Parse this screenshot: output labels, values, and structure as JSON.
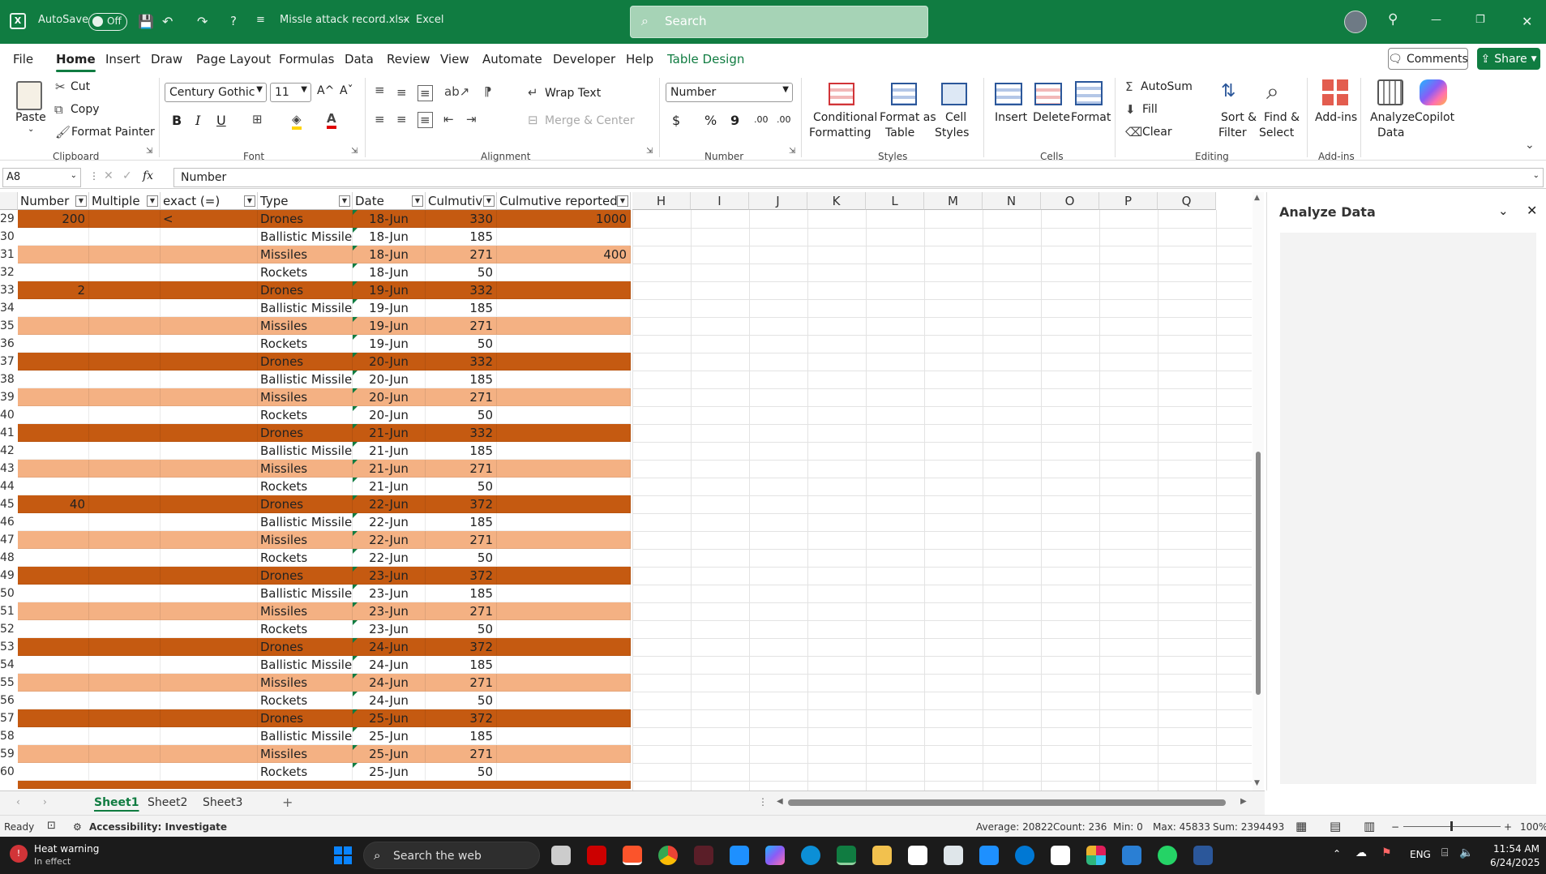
{
  "titlebar": {
    "autosave_label": "AutoSave",
    "autosave_state": "Off",
    "filename": "Missle attack record.xlsx",
    "separator": "-",
    "app_name": "Excel",
    "search_placeholder": "Search"
  },
  "menu": {
    "tabs": [
      "File",
      "Home",
      "Insert",
      "Draw",
      "Page Layout",
      "Formulas",
      "Data",
      "Review",
      "View",
      "Automate",
      "Developer",
      "Help",
      "Table Design"
    ],
    "active": "Home",
    "comments_label": "Comments",
    "share_label": "Share"
  },
  "ribbon": {
    "clipboard": {
      "paste": "Paste",
      "cut": "Cut",
      "copy": "Copy",
      "format_painter": "Format Painter",
      "group": "Clipboard"
    },
    "font": {
      "name": "Century Gothic",
      "size": "11",
      "bold": "B",
      "italic": "I",
      "underline": "U",
      "grow": "A^",
      "shrink": "Aˇ",
      "group": "Font"
    },
    "alignment": {
      "wrap_text": "Wrap Text",
      "merge_center": "Merge & Center",
      "group": "Alignment"
    },
    "number": {
      "format": "Number",
      "currency": "$",
      "percent": "%",
      "comma": "9",
      "increase_decimal": ".00",
      "decrease_decimal": ".00",
      "group": "Number"
    },
    "styles": {
      "conditional": "Conditional",
      "conditional_2": "Formatting",
      "format_table": "Format as",
      "format_table_2": "Table",
      "cell_styles": "Cell",
      "cell_styles_2": "Styles",
      "group": "Styles"
    },
    "cells": {
      "insert": "Insert",
      "delete": "Delete",
      "format": "Format",
      "group": "Cells"
    },
    "editing": {
      "autosum": "AutoSum",
      "fill": "Fill",
      "clear": "Clear",
      "sort": "Sort &",
      "sort_2": "Filter",
      "find": "Find &",
      "find_2": "Select",
      "group": "Editing"
    },
    "addins": {
      "addins": "Add-ins",
      "group": "Add-ins"
    },
    "analyze": {
      "label": "Analyze",
      "label_2": "Data"
    },
    "copilot": {
      "label": "Copilot"
    }
  },
  "formula_bar": {
    "name_box": "A8",
    "fx": "fx",
    "content": "Number"
  },
  "sheet": {
    "headers": [
      "Number",
      "Multiple",
      "exact (=)",
      "Type",
      "Date",
      "Culmutive",
      "Culmutive reported"
    ],
    "extra_columns": [
      "H",
      "I",
      "J",
      "K",
      "L",
      "M",
      "N",
      "O",
      "P",
      "Q"
    ],
    "rows": [
      {
        "n": "29",
        "num": "200",
        "mult": "",
        "exact": "<",
        "type": "Drones",
        "date": "18-Jun",
        "cum": "330",
        "rep": "1000",
        "band": "dark"
      },
      {
        "n": "30",
        "num": "",
        "mult": "",
        "exact": "",
        "type": "Ballistic Missiles",
        "date": "18-Jun",
        "cum": "185",
        "rep": "",
        "band": "white"
      },
      {
        "n": "31",
        "num": "",
        "mult": "",
        "exact": "",
        "type": "Missiles",
        "date": "18-Jun",
        "cum": "271",
        "rep": "400",
        "band": "light"
      },
      {
        "n": "32",
        "num": "",
        "mult": "",
        "exact": "",
        "type": "Rockets",
        "date": "18-Jun",
        "cum": "50",
        "rep": "",
        "band": "white"
      },
      {
        "n": "33",
        "num": "2",
        "mult": "",
        "exact": "",
        "type": "Drones",
        "date": "19-Jun",
        "cum": "332",
        "rep": "",
        "band": "dark"
      },
      {
        "n": "34",
        "num": "",
        "mult": "",
        "exact": "",
        "type": "Ballistic Missiles",
        "date": "19-Jun",
        "cum": "185",
        "rep": "",
        "band": "white"
      },
      {
        "n": "35",
        "num": "",
        "mult": "",
        "exact": "",
        "type": "Missiles",
        "date": "19-Jun",
        "cum": "271",
        "rep": "",
        "band": "light"
      },
      {
        "n": "36",
        "num": "",
        "mult": "",
        "exact": "",
        "type": "Rockets",
        "date": "19-Jun",
        "cum": "50",
        "rep": "",
        "band": "white"
      },
      {
        "n": "37",
        "num": "",
        "mult": "",
        "exact": "",
        "type": "Drones",
        "date": "20-Jun",
        "cum": "332",
        "rep": "",
        "band": "dark"
      },
      {
        "n": "38",
        "num": "",
        "mult": "",
        "exact": "",
        "type": "Ballistic Missiles",
        "date": "20-Jun",
        "cum": "185",
        "rep": "",
        "band": "white"
      },
      {
        "n": "39",
        "num": "",
        "mult": "",
        "exact": "",
        "type": "Missiles",
        "date": "20-Jun",
        "cum": "271",
        "rep": "",
        "band": "light"
      },
      {
        "n": "40",
        "num": "",
        "mult": "",
        "exact": "",
        "type": "Rockets",
        "date": "20-Jun",
        "cum": "50",
        "rep": "",
        "band": "white"
      },
      {
        "n": "41",
        "num": "",
        "mult": "",
        "exact": "",
        "type": "Drones",
        "date": "21-Jun",
        "cum": "332",
        "rep": "",
        "band": "dark"
      },
      {
        "n": "42",
        "num": "",
        "mult": "",
        "exact": "",
        "type": "Ballistic Missiles",
        "date": "21-Jun",
        "cum": "185",
        "rep": "",
        "band": "white"
      },
      {
        "n": "43",
        "num": "",
        "mult": "",
        "exact": "",
        "type": "Missiles",
        "date": "21-Jun",
        "cum": "271",
        "rep": "",
        "band": "light"
      },
      {
        "n": "44",
        "num": "",
        "mult": "",
        "exact": "",
        "type": "Rockets",
        "date": "21-Jun",
        "cum": "50",
        "rep": "",
        "band": "white"
      },
      {
        "n": "45",
        "num": "40",
        "mult": "",
        "exact": "",
        "type": "Drones",
        "date": "22-Jun",
        "cum": "372",
        "rep": "",
        "band": "dark"
      },
      {
        "n": "46",
        "num": "",
        "mult": "",
        "exact": "",
        "type": "Ballistic Missiles",
        "date": "22-Jun",
        "cum": "185",
        "rep": "",
        "band": "white"
      },
      {
        "n": "47",
        "num": "",
        "mult": "",
        "exact": "",
        "type": "Missiles",
        "date": "22-Jun",
        "cum": "271",
        "rep": "",
        "band": "light"
      },
      {
        "n": "48",
        "num": "",
        "mult": "",
        "exact": "",
        "type": "Rockets",
        "date": "22-Jun",
        "cum": "50",
        "rep": "",
        "band": "white"
      },
      {
        "n": "49",
        "num": "",
        "mult": "",
        "exact": "",
        "type": "Drones",
        "date": "23-Jun",
        "cum": "372",
        "rep": "",
        "band": "dark"
      },
      {
        "n": "50",
        "num": "",
        "mult": "",
        "exact": "",
        "type": "Ballistic Missiles",
        "date": "23-Jun",
        "cum": "185",
        "rep": "",
        "band": "white"
      },
      {
        "n": "51",
        "num": "",
        "mult": "",
        "exact": "",
        "type": "Missiles",
        "date": "23-Jun",
        "cum": "271",
        "rep": "",
        "band": "light"
      },
      {
        "n": "52",
        "num": "",
        "mult": "",
        "exact": "",
        "type": "Rockets",
        "date": "23-Jun",
        "cum": "50",
        "rep": "",
        "band": "white"
      },
      {
        "n": "53",
        "num": "",
        "mult": "",
        "exact": "",
        "type": "Drones",
        "date": "24-Jun",
        "cum": "372",
        "rep": "",
        "band": "dark"
      },
      {
        "n": "54",
        "num": "",
        "mult": "",
        "exact": "",
        "type": "Ballistic Missiles",
        "date": "24-Jun",
        "cum": "185",
        "rep": "",
        "band": "white"
      },
      {
        "n": "55",
        "num": "",
        "mult": "",
        "exact": "",
        "type": "Missiles",
        "date": "24-Jun",
        "cum": "271",
        "rep": "",
        "band": "light"
      },
      {
        "n": "56",
        "num": "",
        "mult": "",
        "exact": "",
        "type": "Rockets",
        "date": "24-Jun",
        "cum": "50",
        "rep": "",
        "band": "white"
      },
      {
        "n": "57",
        "num": "",
        "mult": "",
        "exact": "",
        "type": "Drones",
        "date": "25-Jun",
        "cum": "372",
        "rep": "",
        "band": "dark"
      },
      {
        "n": "58",
        "num": "",
        "mult": "",
        "exact": "",
        "type": "Ballistic Missiles",
        "date": "25-Jun",
        "cum": "185",
        "rep": "",
        "band": "white"
      },
      {
        "n": "59",
        "num": "",
        "mult": "",
        "exact": "",
        "type": "Missiles",
        "date": "25-Jun",
        "cum": "271",
        "rep": "",
        "band": "light"
      },
      {
        "n": "60",
        "num": "",
        "mult": "",
        "exact": "",
        "type": "Rockets",
        "date": "25-Jun",
        "cum": "50",
        "rep": "",
        "band": "white"
      }
    ]
  },
  "panel": {
    "title": "Analyze Data"
  },
  "sheet_tabs": [
    "Sheet1",
    "Sheet2",
    "Sheet3"
  ],
  "status": {
    "ready": "Ready",
    "accessibility": "Accessibility: Investigate",
    "average": "Average: 20822",
    "count": "Count: 236",
    "min": "Min: 0",
    "max": "Max: 45833",
    "sum": "Sum: 2394493",
    "zoom": "100%"
  },
  "taskbar": {
    "weather_title": "Heat warning",
    "weather_sub": "In effect",
    "search": "Search the web",
    "lang": "ENG",
    "time": "11:54 AM",
    "date": "6/24/2025"
  },
  "colors": {
    "excel_green": "#107c41",
    "band_dark": "#c55a11",
    "band_light": "#f4b183"
  }
}
